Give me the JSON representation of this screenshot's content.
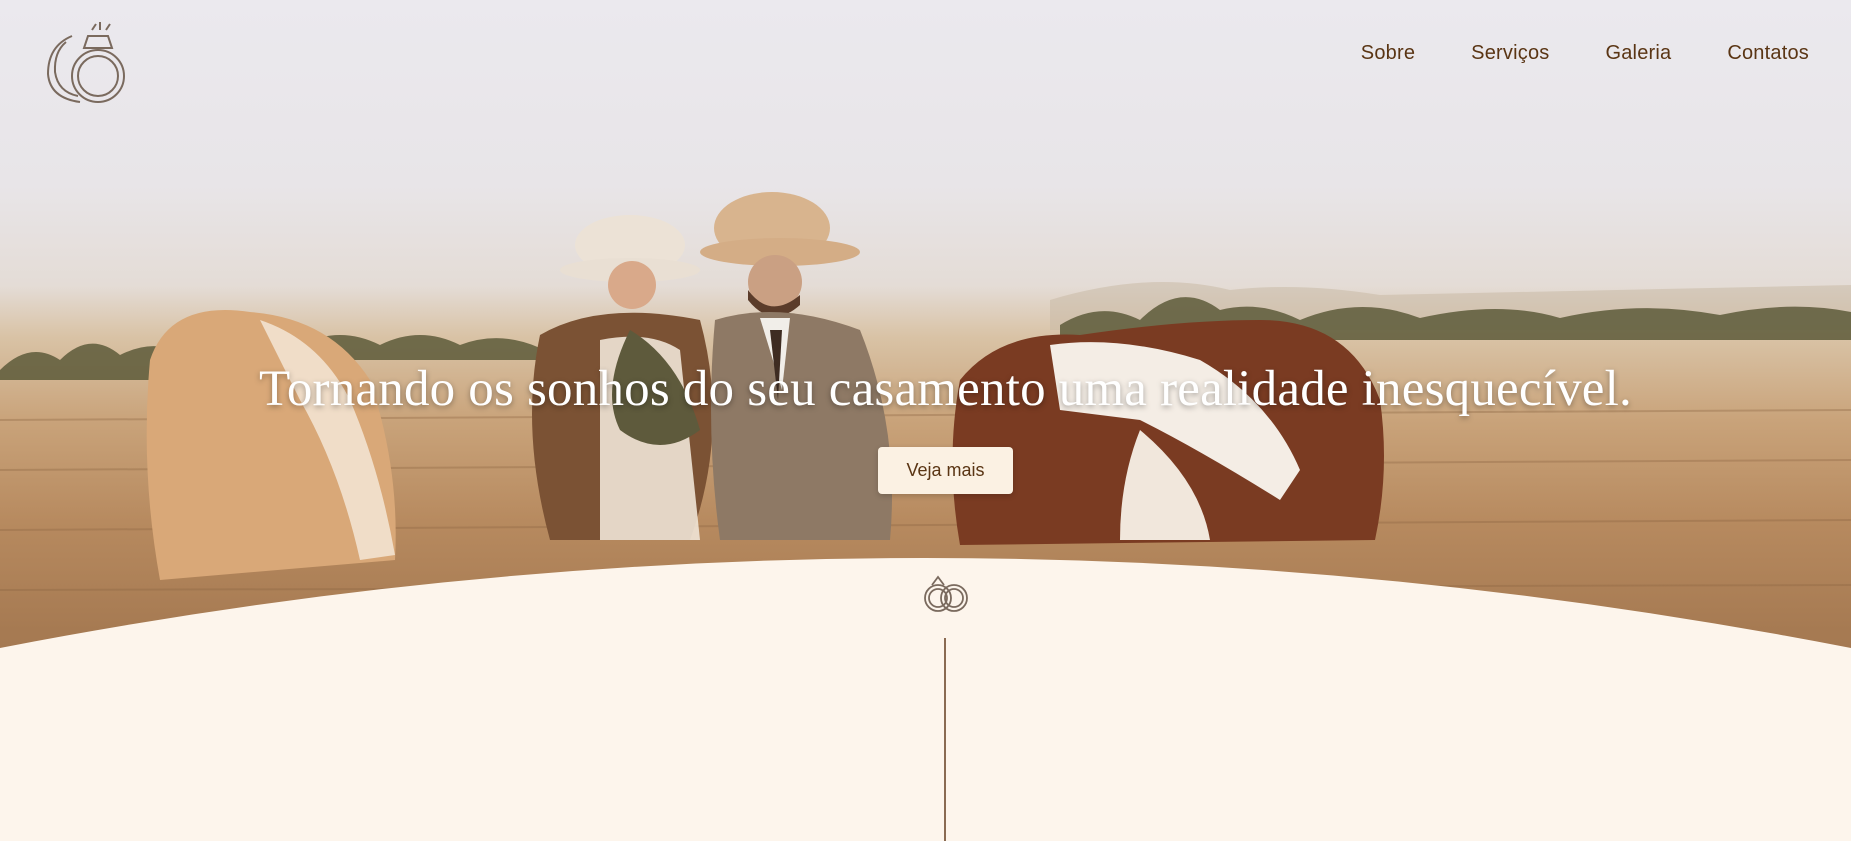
{
  "colors": {
    "nav_text": "#5a3514",
    "cream": "#fdf5ec",
    "button_bg": "#fbf1e3",
    "divider": "#8a6a52"
  },
  "header": {
    "logo_icon": "horseshoe-ring-icon",
    "nav": [
      "Sobre",
      "Serviços",
      "Galeria",
      "Contatos"
    ]
  },
  "hero": {
    "headline": "Tornando os sonhos do seu casamento uma realidade inesquecível.",
    "cta_label": "Veja mais"
  },
  "section": {
    "icon": "wedding-rings-icon"
  }
}
